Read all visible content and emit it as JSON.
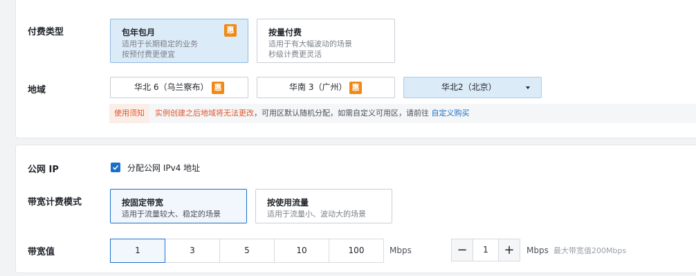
{
  "billing": {
    "label": "付费类型",
    "options": [
      {
        "title": "包年包月",
        "desc1": "适用于长期稳定的业务",
        "desc2": "按预付费更便宜",
        "badge": "惠"
      },
      {
        "title": "按量付费",
        "desc1": "适用于有大幅波动的场景",
        "desc2": "秒级计费更灵活"
      }
    ]
  },
  "region": {
    "label": "地域",
    "options": [
      {
        "name": "华北 6（乌兰察布）",
        "badge": "惠"
      },
      {
        "name": "华南 3（广州）",
        "badge": "惠"
      },
      {
        "name": "华北2（北京）"
      }
    ],
    "notice_tag": "使用须知",
    "notice_warn": "实例创建之后地域将无法更改",
    "notice_normal": "，可用区默认随机分配，如需自定义可用区，请前往",
    "notice_link": "自定义购买"
  },
  "public_ip": {
    "label": "公网 IP",
    "checkbox_label": "分配公网 IPv4 地址",
    "checked": true
  },
  "bw_mode": {
    "label": "带宽计费模式",
    "options": [
      {
        "title": "按固定带宽",
        "desc": "适用于流量较大、稳定的场景"
      },
      {
        "title": "按使用流量",
        "desc": "适用于流量小、波动大的场景"
      }
    ]
  },
  "bandwidth": {
    "label": "带宽值",
    "presets": [
      "1",
      "3",
      "5",
      "10",
      "100"
    ],
    "unit": "Mbps",
    "stepper_value": "1",
    "stepper_unit": "Mbps",
    "max_hint": "最大带宽值200Mbps"
  },
  "colors": {
    "accent": "#1a6fc9",
    "badge": "#f08a15",
    "warning": "#e0562e"
  }
}
